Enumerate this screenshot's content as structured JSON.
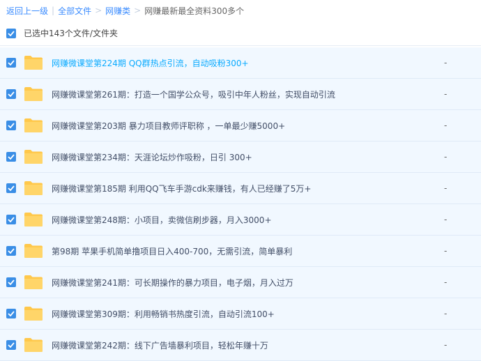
{
  "breadcrumb": {
    "back": "返回上一级",
    "all_files": "全部文件",
    "category": "网赚类",
    "current": "网赚最新最全资料300多个"
  },
  "selection": {
    "label": "已选中143个文件/文件夹"
  },
  "colors": {
    "checkbox": "#3a8ee6",
    "folder": "#ffc84b",
    "link": "#3b8cff",
    "highlight_text": "#09aaff",
    "row_background": "#f1f8ff"
  },
  "files": [
    {
      "name": "网赚微课堂第224期 QQ群热点引流，自动吸粉300+",
      "size": "-",
      "checked": true,
      "highlight": true
    },
    {
      "name": "网赚微课堂第261期：打造一个国学公众号，吸引中年人粉丝，实现自动引流",
      "size": "-",
      "checked": true
    },
    {
      "name": "网赚微课堂第203期 暴力项目教师评职称 ，一单最少赚5000+",
      "size": "-",
      "checked": true
    },
    {
      "name": "网赚微课堂第234期：天涯论坛炒作吸粉，日引 300+",
      "size": "-",
      "checked": true
    },
    {
      "name": "网赚微课堂第185期 利用QQ飞车手游cdk来赚钱，有人已经赚了5万+",
      "size": "-",
      "checked": true
    },
    {
      "name": "网赚微课堂第248期：小项目，卖微信刷步器，月入3000+",
      "size": "-",
      "checked": true
    },
    {
      "name": "第98期 苹果手机简单撸项目日入400-700，无需引流，简单暴利",
      "size": "-",
      "checked": true
    },
    {
      "name": "网赚微课堂第241期：可长期操作的暴力项目，电子烟，月入过万",
      "size": "-",
      "checked": true
    },
    {
      "name": "网赚微课堂第309期：利用畅销书热度引流，自动引流100+",
      "size": "-",
      "checked": true
    },
    {
      "name": "网赚微课堂第242期：线下广告墙暴利项目，轻松年赚十万",
      "size": "-",
      "checked": true
    }
  ]
}
